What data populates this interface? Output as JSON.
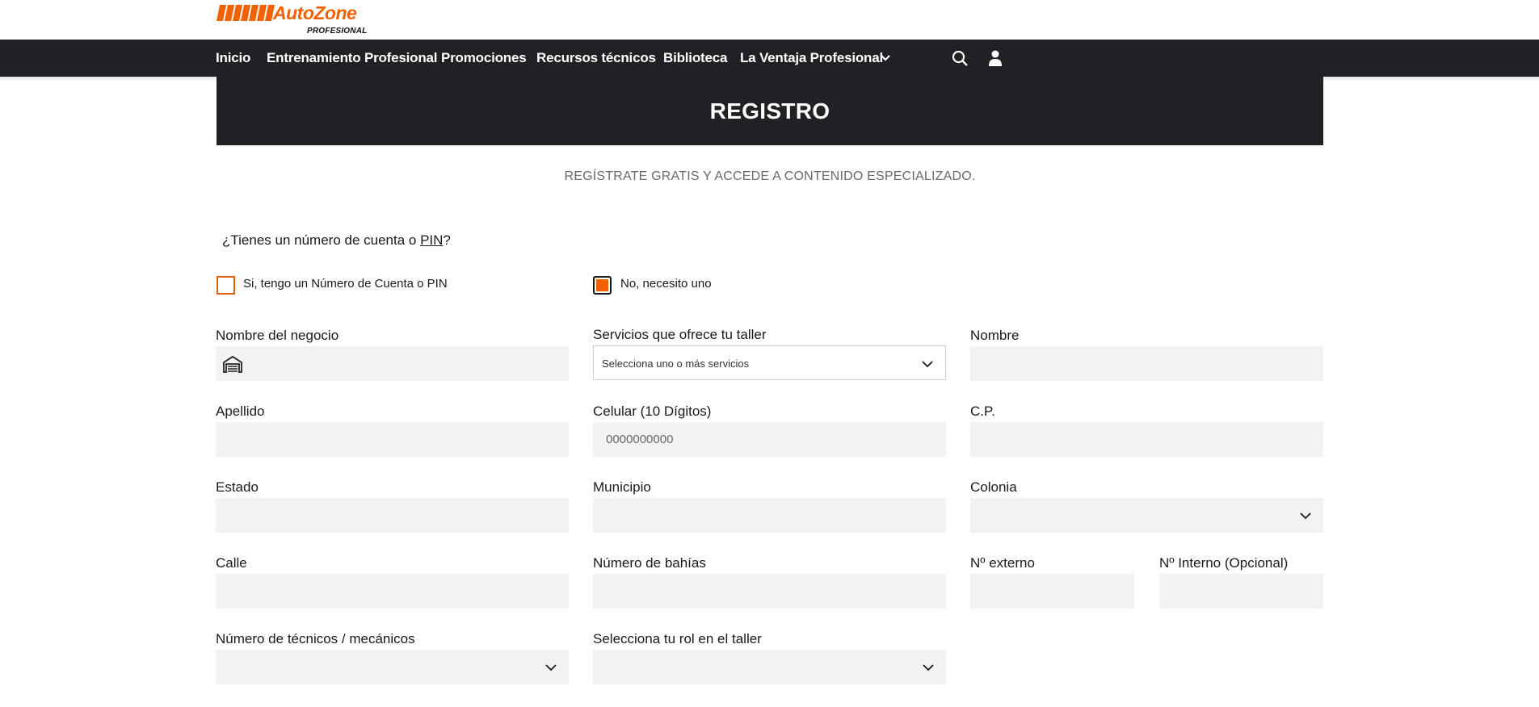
{
  "brand": {
    "name": "AutoZone",
    "sub": "PROFESIONAL",
    "accent": "#f26100"
  },
  "nav": {
    "items": [
      "Inicio",
      "Entrenamiento Profesional",
      "Promociones",
      "Recursos técnicos",
      "Biblioteca",
      "La Ventaja Profesional"
    ],
    "icons": [
      "chevron-down-icon",
      "search-icon",
      "user-icon"
    ],
    "background": "#202124"
  },
  "banner": {
    "title": "REGISTRO"
  },
  "subtitle": "REGÍSTRATE GRATIS Y ACCEDE A CONTENIDO ESPECIALIZADO.",
  "account_question": {
    "text_before": "¿Tienes un número de cuenta o ",
    "pin": "PIN",
    "text_after": "?"
  },
  "options": {
    "yes": {
      "label": "Si, tengo un Número de Cuenta o PIN",
      "checked": false
    },
    "no": {
      "label": "No, necesito uno",
      "checked": true
    }
  },
  "form": {
    "business_name": {
      "label": "Nombre del negocio",
      "value": ""
    },
    "services": {
      "label": "Servicios que ofrece tu taller",
      "placeholder": "Selecciona uno o más servicios"
    },
    "first_name": {
      "label": "Nombre",
      "value": ""
    },
    "last_name": {
      "label": "Apellido",
      "value": ""
    },
    "cellphone": {
      "label": "Celular (10 Dígitos)",
      "placeholder": "0000000000"
    },
    "zip": {
      "label": "C.P.",
      "value": ""
    },
    "state": {
      "label": "Estado",
      "value": ""
    },
    "municipality": {
      "label": "Municipio",
      "value": ""
    },
    "neighborhood": {
      "label": "Colonia",
      "value": ""
    },
    "street": {
      "label": "Calle",
      "value": ""
    },
    "bays": {
      "label": "Número de bahías",
      "value": ""
    },
    "ext_number": {
      "label": "Nº externo",
      "value": ""
    },
    "int_number": {
      "label": "Nº Interno (Opcional)",
      "value": ""
    },
    "technicians": {
      "label": "Número de técnicos / mecánicos",
      "value": ""
    },
    "role": {
      "label": "Selecciona tu rol en el taller",
      "value": ""
    }
  }
}
